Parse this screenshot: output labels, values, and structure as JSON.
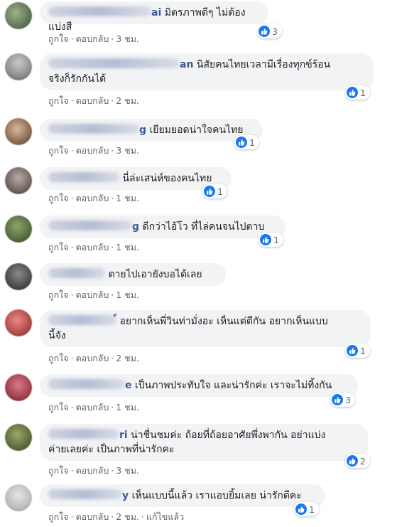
{
  "comments": [
    {
      "author_tail": "ai",
      "text_lines": [
        "มิตรภาพดีๆ ไม่ต้องแบ่งสี"
      ],
      "actions": {
        "like": "ถูกใจ",
        "reply": "ตอบกลับ",
        "time": "3 ชม.",
        "edited": ""
      },
      "reactions": "3"
    },
    {
      "author_tail": "an",
      "text_lines": [
        "นิสัยคนไทยเวลามีเรื่องทุกข์ร้อน",
        "จริงก็รักกันได้"
      ],
      "actions": {
        "like": "ถูกใจ",
        "reply": "ตอบกลับ",
        "time": "2 ชม.",
        "edited": ""
      },
      "reactions": "1"
    },
    {
      "author_tail": "g",
      "text_lines": [
        "เยียมยอดน่าใจคนไทย"
      ],
      "actions": {
        "like": "ถูกใจ",
        "reply": "ตอบกลับ",
        "time": "3 ชม.",
        "edited": ""
      },
      "reactions": "1"
    },
    {
      "author_tail": "",
      "text_lines": [
        "นี่ล่ะเสน่ห์ของคนไทย"
      ],
      "actions": {
        "like": "ถูกใจ",
        "reply": "ตอบกลับ",
        "time": "1 ชม.",
        "edited": ""
      },
      "reactions": "1"
    },
    {
      "author_tail": "g",
      "text_lines": [
        "ดีกว่าไอ้โว ที่ไล่คนจนไปตาบ"
      ],
      "actions": {
        "like": "ถูกใจ",
        "reply": "ตอบกลับ",
        "time": "1 ชม.",
        "edited": ""
      },
      "reactions": "1"
    },
    {
      "author_tail": "",
      "text_lines": [
        "ตายไปเอายังบอได้เลย"
      ],
      "actions": {
        "like": "ถูกใจ",
        "reply": "ตอบกลับ",
        "time": "1 ชม.",
        "edited": ""
      },
      "reactions": ""
    },
    {
      "author_tail": "์",
      "text_lines": [
        "อยากเห็นพี่วินท่ามั่งอะ เห็นแต่ตีกัน อยากเห็นแบบ",
        "นี้จัง"
      ],
      "actions": {
        "like": "ถูกใจ",
        "reply": "ตอบกลับ",
        "time": "2 ชม.",
        "edited": ""
      },
      "reactions": "1"
    },
    {
      "author_tail": "e",
      "text_lines": [
        "เป็นภาพประทับใจ และน่ารักค่ะ เราจะไม่ทิ้งกัน"
      ],
      "actions": {
        "like": "ถูกใจ",
        "reply": "ตอบกลับ",
        "time": "1 ชม.",
        "edited": ""
      },
      "reactions": "3"
    },
    {
      "author_tail": "ri",
      "text_lines": [
        "น่าชื่นชมค่ะ ถ้อยที่ถ้อยอาศัยพึ่งพากัน อย่าแบ่ง",
        "ค่ายเลยค่ะ เป็นภาพที่น่ารักคะ"
      ],
      "actions": {
        "like": "ถูกใจ",
        "reply": "ตอบกลับ",
        "time": "3 ชม.",
        "edited": ""
      },
      "reactions": "2"
    },
    {
      "author_tail": "y",
      "text_lines": [
        "เห็นแบบนี้แล้ว เราแอบยิ้มเลย น่ารักดีคะ"
      ],
      "actions": {
        "like": "ถูกใจ",
        "reply": "ตอบกลับ",
        "time": "2 ชม.",
        "edited": "แก้ไขแล้ว"
      },
      "reactions": "1"
    }
  ],
  "colors": {
    "bubble_bg": "#f2f3f5",
    "like_blue": "#1877f2",
    "meta_gray": "#606770",
    "name_blue": "#385898"
  },
  "icons": {
    "reaction": "thumbs-up-icon"
  }
}
